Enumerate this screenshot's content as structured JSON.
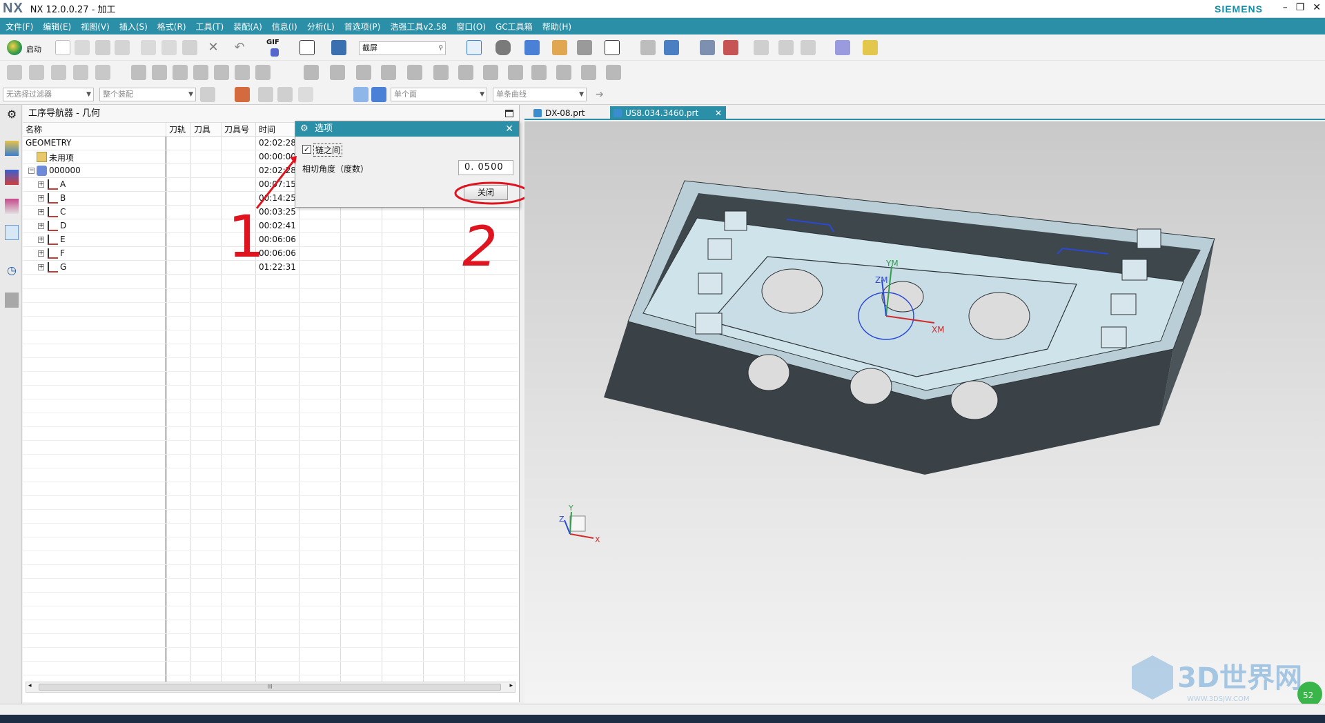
{
  "app": {
    "logo": "NX",
    "title": "NX 12.0.0.27 - 加工",
    "brand": "SIEMENS",
    "window_buttons": [
      "–",
      "❐",
      "✕"
    ]
  },
  "menu": [
    "文件(F)",
    "编辑(E)",
    "视图(V)",
    "插入(S)",
    "格式(R)",
    "工具(T)",
    "装配(A)",
    "信息(I)",
    "分析(L)",
    "首选项(P)",
    "浩强工具v2.58",
    "窗口(O)",
    "GC工具箱",
    "帮助(H)"
  ],
  "toolbar": {
    "start_label": "启动",
    "gif_label": "GIF",
    "capture_field": "截屏",
    "filter_combo": "无选择过滤器",
    "assembly_combo": "整个装配",
    "face_combo": "单个面",
    "curve_combo": "单条曲线"
  },
  "navigator": {
    "title": "工序导航器 - 几何",
    "columns": [
      "名称",
      "刀轨",
      "刀具",
      "刀具号",
      "时间"
    ],
    "rows": [
      {
        "name": "GEOMETRY",
        "time": "02:02:28"
      },
      {
        "name": "未用项",
        "time": "00:00:00"
      },
      {
        "name": "000000",
        "time": "02:02:28"
      },
      {
        "name": "A",
        "time": "00:07:15"
      },
      {
        "name": "B",
        "time": "00:14:25"
      },
      {
        "name": "C",
        "time": "00:03:25"
      },
      {
        "name": "D",
        "time": "00:02:41"
      },
      {
        "name": "E",
        "time": "00:06:06"
      },
      {
        "name": "F",
        "time": "00:06:06"
      },
      {
        "name": "G",
        "time": "01:22:31"
      }
    ],
    "scroll_grip": "III"
  },
  "dialog": {
    "title": "选项",
    "checkbox_label": "链之间",
    "checkbox_checked": true,
    "angle_label": "相切角度（度数）",
    "angle_value": "0. 0500",
    "close_label": "关闭"
  },
  "annotations": {
    "mark1": "1",
    "mark2": "2",
    "color": "#e0141e"
  },
  "tabs": [
    {
      "label": "DX-08.prt",
      "active": false
    },
    {
      "label": "US8.034.3460.prt",
      "active": true
    }
  ],
  "viewport": {
    "axis_labels": {
      "ym": "YM",
      "zm": "ZM",
      "xm": "XM",
      "x": "X",
      "y": "Y",
      "z": "Z"
    },
    "watermark": "3D世界网",
    "watermark_url": "WWW.3DSJW.COM",
    "badge": "52"
  },
  "colors": {
    "accent": "#2b8fa7",
    "model_top": "#cfe3ea",
    "model_dark": "#3a4247"
  }
}
